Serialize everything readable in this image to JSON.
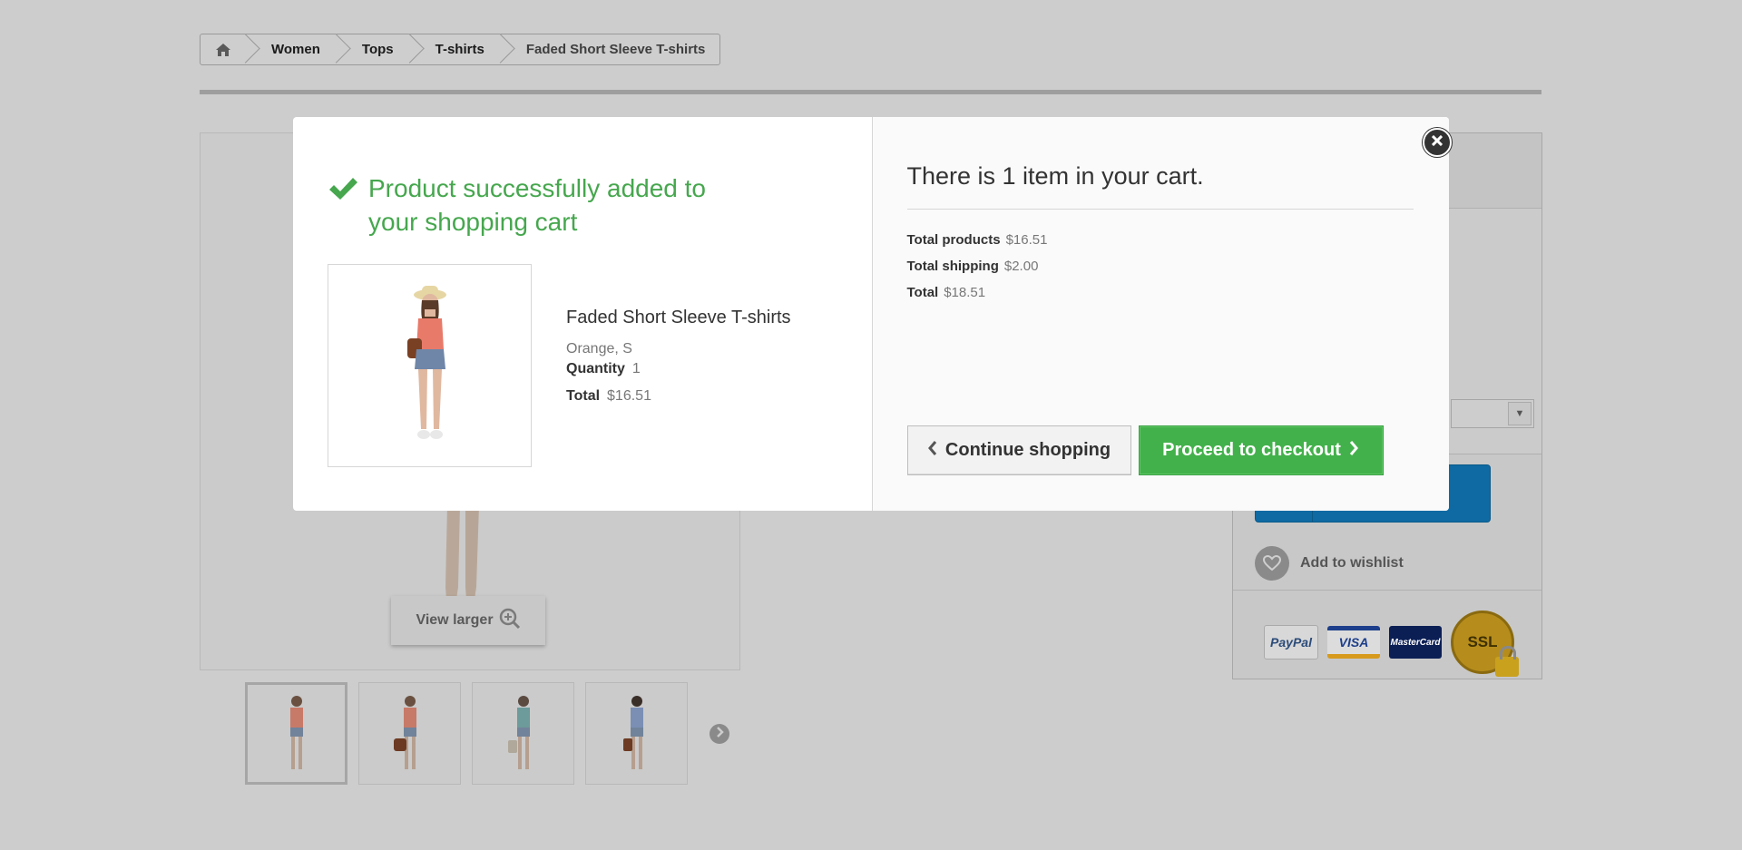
{
  "breadcrumb": {
    "items": [
      "Women",
      "Tops",
      "T-shirts"
    ],
    "current": "Faded Short Sleeve T-shirts"
  },
  "gallery": {
    "view_larger": "View larger"
  },
  "sidebar": {
    "wishlist_label": "Add to wishlist",
    "payments": [
      "PayPal",
      "VISA",
      "MasterCard",
      "SSL"
    ]
  },
  "modal": {
    "success_title": "Product successfully added to your shopping cart",
    "product": {
      "name": "Faded Short Sleeve T-shirts",
      "attributes": "Orange, S",
      "quantity_label": "Quantity",
      "quantity": "1",
      "total_label": "Total",
      "total": "$16.51"
    },
    "cart": {
      "count_text": "There is 1 item in your cart.",
      "total_products_label": "Total products",
      "total_products": "$16.51",
      "total_shipping_label": "Total shipping",
      "total_shipping": "$2.00",
      "total_label": "Total",
      "total": "$18.51"
    },
    "continue_label": "Continue shopping",
    "checkout_label": "Proceed to checkout"
  },
  "colors": {
    "success": "#46a74e",
    "checkout_bg": "#43b14b",
    "overlay": "#cdcdcd",
    "add_to_cart": "#0f6aa3"
  }
}
